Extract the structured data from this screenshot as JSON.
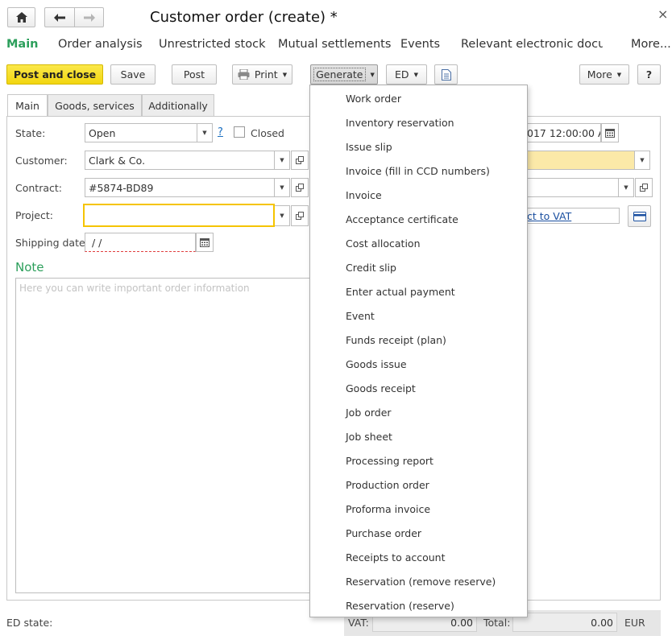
{
  "window": {
    "title": "Customer order (create) *",
    "close_glyph": "×",
    "home_icon": "home-icon",
    "back_icon": "arrow-left-icon",
    "forward_icon": "arrow-right-icon"
  },
  "nav_tabs": [
    {
      "label": "Main",
      "active": true
    },
    {
      "label": "Order analysis"
    },
    {
      "label": "Unrestricted stock"
    },
    {
      "label": "Mutual settlements"
    },
    {
      "label": "Events"
    },
    {
      "label": "Relevant electronic docu..."
    },
    {
      "label": "More..."
    }
  ],
  "toolbar": {
    "post_close": "Post and close",
    "save": "Save",
    "post": "Post",
    "print": "Print",
    "generate": "Generate",
    "ed": "ED",
    "more": "More",
    "help": "?"
  },
  "sub_tabs": [
    "Main",
    "Goods, services",
    "Additionally"
  ],
  "form": {
    "state_label": "State:",
    "state_value": "Open",
    "state_help": "?",
    "closed_label": "Closed",
    "customer_label": "Customer:",
    "customer_value": "Clark & Co.",
    "contract_label": "Contract:",
    "contract_value": "#5874-BD89",
    "project_label": "Project:",
    "project_value": "",
    "shipping_label": "Shipping date:",
    "shipping_value": "  /  /",
    "date_fragment": "017 12:00:00 AI",
    "vat_link_fragment": "ct to VAT"
  },
  "note": {
    "title": "Note",
    "placeholder": "Here you can write important order information"
  },
  "generate_menu": [
    "Work order",
    "Inventory reservation",
    "Issue slip",
    "Invoice (fill in CCD numbers)",
    "Invoice",
    "Acceptance certificate",
    "Cost allocation",
    "Credit slip",
    "Enter actual payment",
    "Event",
    "Funds receipt (plan)",
    "Goods issue",
    "Goods receipt",
    "Job order",
    "Job sheet",
    "Processing report",
    "Production order",
    "Proforma invoice",
    "Purchase order",
    "Receipts to account",
    "Reservation (remove reserve)",
    "Reservation (reserve)"
  ],
  "footer": {
    "ed_state_label": "ED state:",
    "vat_label": "VAT:",
    "vat_value": "0.00",
    "total_label": "Total:",
    "total_value": "0.00",
    "currency": "EUR"
  },
  "colors": {
    "accent_green": "#2c9f5b",
    "primary_button": "#f5de1c",
    "focus_border": "#f5c400",
    "required_field": "#fbe9a8"
  }
}
